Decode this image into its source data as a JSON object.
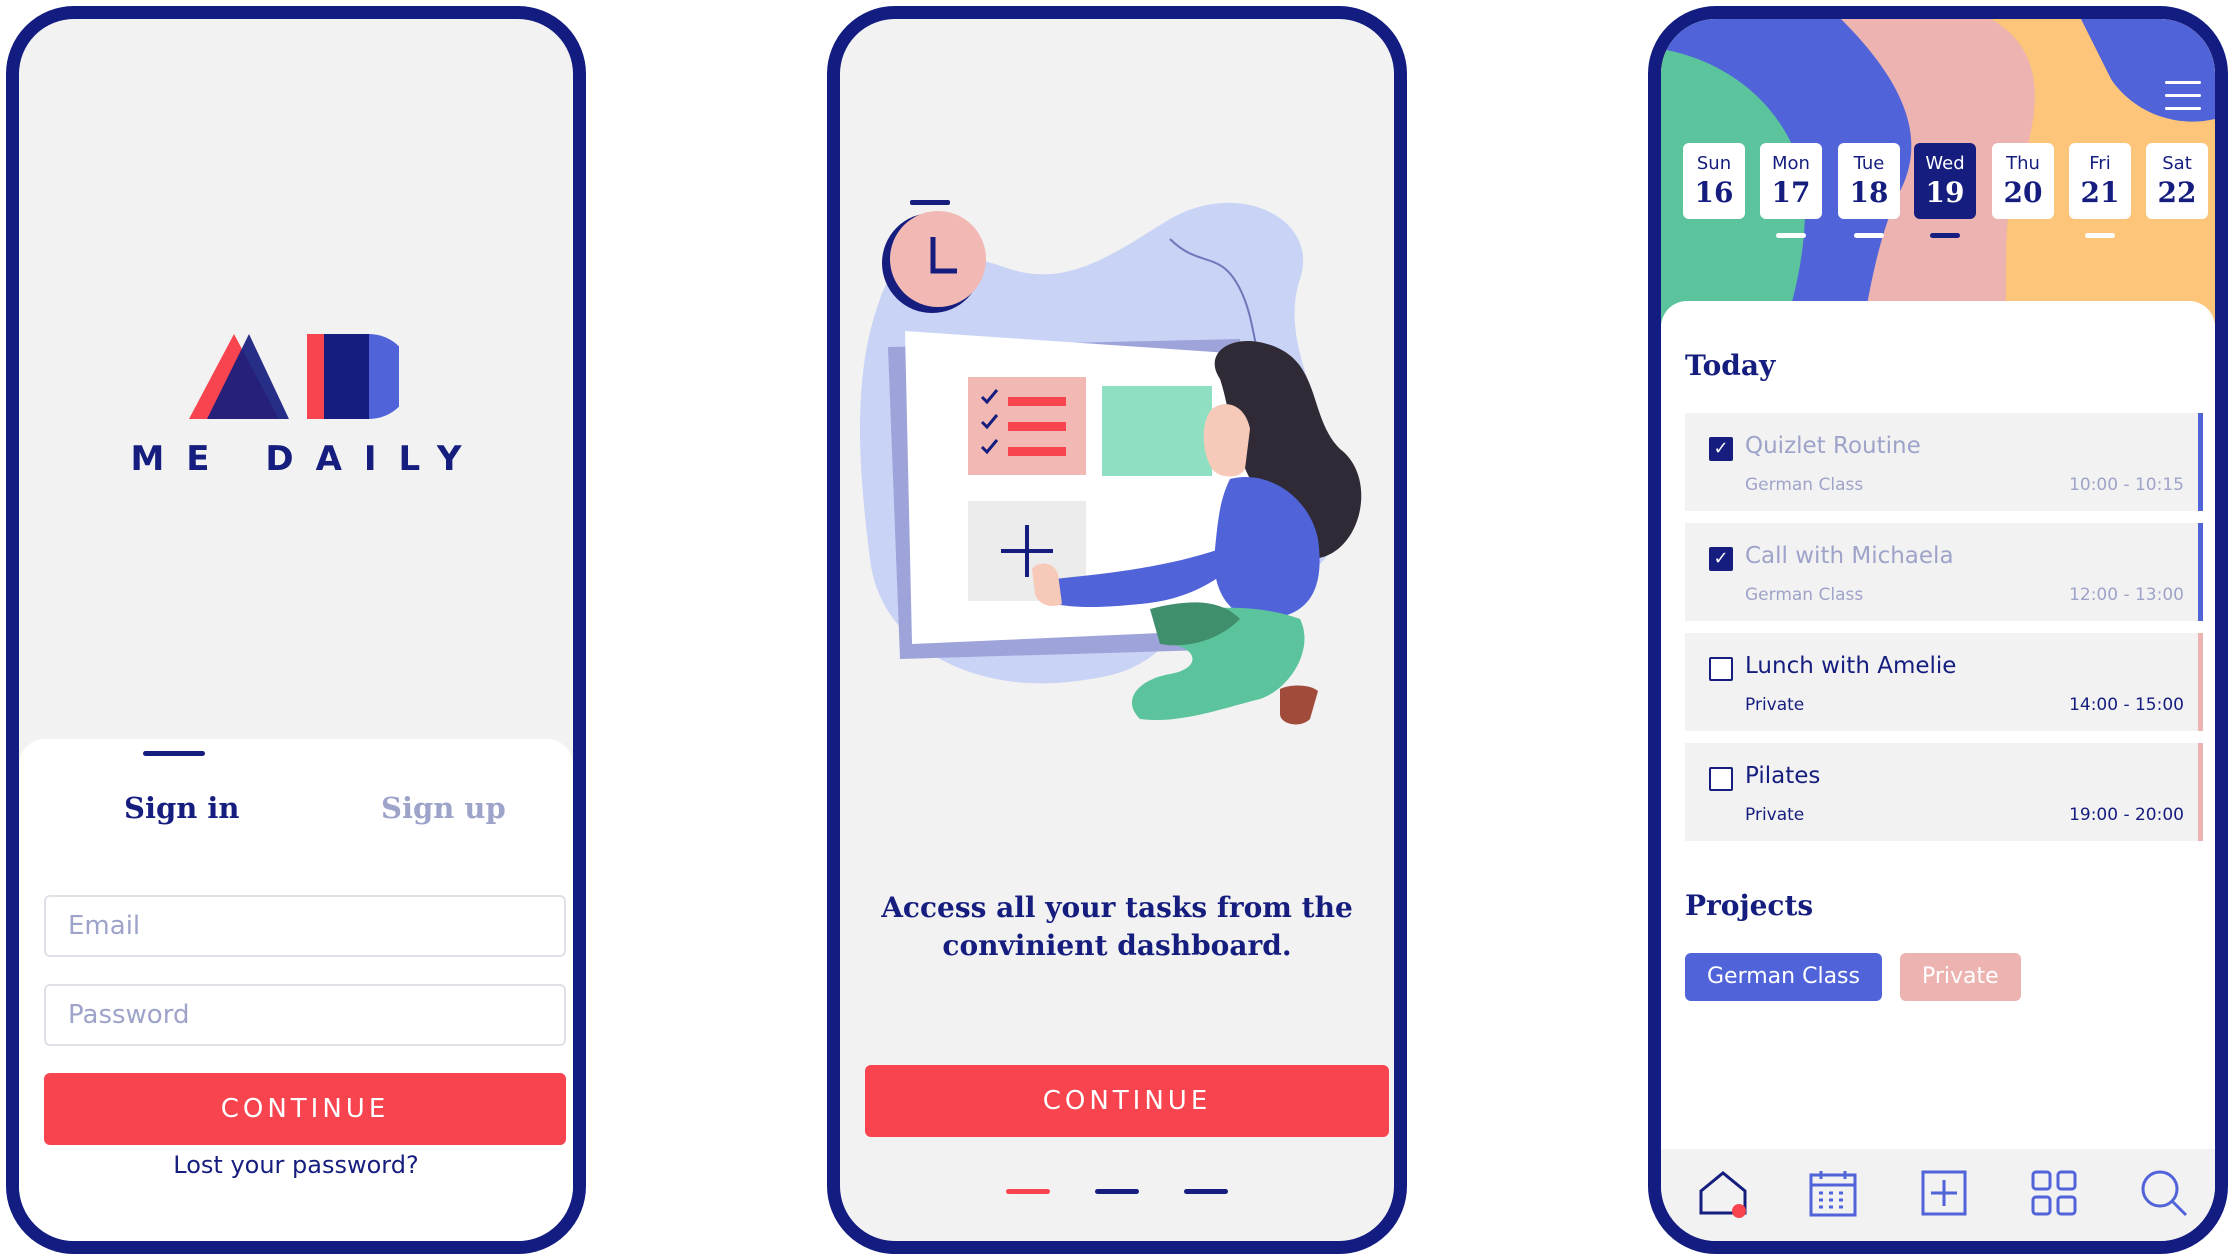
{
  "colors": {
    "navy": "#151d7e",
    "frame": "#131c80",
    "accent_red": "#f7444f",
    "muted_lavender": "#9ea3c9",
    "blue": "#5063d9",
    "pink": "#ecb3b0",
    "green": "#5bc49c",
    "yellow": "#fcc579"
  },
  "signin_screen": {
    "app_name": "ME DAILY",
    "logo": "me-daily-logo",
    "tabs": [
      {
        "label": "Sign in",
        "active": true
      },
      {
        "label": "Sign up",
        "active": false
      }
    ],
    "email": {
      "value": "",
      "placeholder": "Email"
    },
    "password": {
      "value": "",
      "placeholder": "Password"
    },
    "continue_label": "CONTINUE",
    "lost_password": "Lost your password?"
  },
  "onboarding_screen": {
    "illustration": "woman-using-dashboard-illustration",
    "message": "Access all your tasks from the convinient dashboard.",
    "continue_label": "CONTINUE",
    "pager": {
      "count": 3,
      "active": 1
    }
  },
  "dashboard_screen": {
    "menu_icon": "hamburger-menu-icon",
    "days": [
      {
        "name": "Sun",
        "num": "16",
        "selected": false,
        "marked": false
      },
      {
        "name": "Mon",
        "num": "17",
        "selected": false,
        "marked": true
      },
      {
        "name": "Tue",
        "num": "18",
        "selected": false,
        "marked": true
      },
      {
        "name": "Wed",
        "num": "19",
        "selected": true,
        "marked": true
      },
      {
        "name": "Thu",
        "num": "20",
        "selected": false,
        "marked": false
      },
      {
        "name": "Fri",
        "num": "21",
        "selected": false,
        "marked": true
      },
      {
        "name": "Sat",
        "num": "22",
        "selected": false,
        "marked": false
      }
    ],
    "today_title": "Today",
    "tasks": [
      {
        "title": "Quizlet Routine",
        "category": "German Class",
        "time": "10:00 - 10:15",
        "done": true
      },
      {
        "title": "Call with Michaela",
        "category": "German Class",
        "time": "12:00 - 13:00",
        "done": true
      },
      {
        "title": "Lunch with Amelie",
        "category": "Private",
        "time": "14:00 - 15:00",
        "done": false
      },
      {
        "title": "Pilates",
        "category": "Private",
        "time": "19:00 - 20:00",
        "done": false
      }
    ],
    "projects_title": "Projects",
    "projects": [
      "German Class",
      "Private"
    ],
    "nav_icons": [
      "home-icon",
      "calendar-icon",
      "add-icon",
      "grid-icon",
      "search-icon"
    ]
  }
}
